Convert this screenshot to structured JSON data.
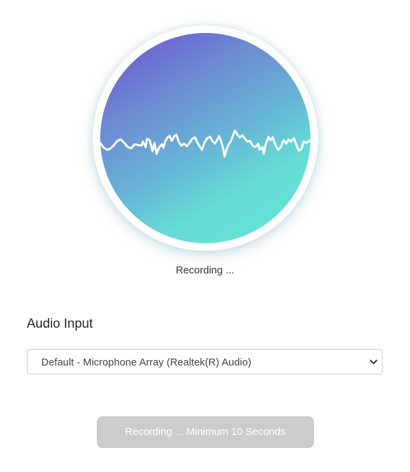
{
  "recorder": {
    "status_text": "Recording ...",
    "waveform_icon": "audio-waveform-icon"
  },
  "audio_input": {
    "title": "Audio Input",
    "selected_device": "Default - Microphone Array (Realtek(R) Audio)",
    "dropdown_icon": "chevron-down-icon"
  },
  "record_button": {
    "label": "Recording ... Minimum 10 Seconds",
    "disabled": true
  },
  "colors": {
    "gradient_start": "#6a4fd3",
    "gradient_mid": "#67b2d6",
    "gradient_end": "#64e6d6",
    "button_disabled": "#cccccc"
  }
}
